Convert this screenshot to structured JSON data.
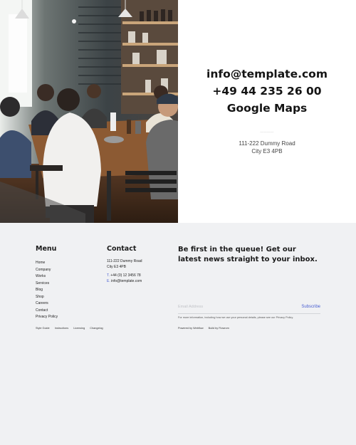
{
  "hero": {
    "photo_alt": "people-meeting-photo",
    "email": "info@template.com",
    "phone": "+49 44 235 26 00",
    "maps_link": "Google Maps",
    "separator_label": "————",
    "address_line1": "111-222 Dummy Road",
    "address_line2": "City E3 4PB"
  },
  "footer": {
    "menu": {
      "title": "Menu",
      "items": [
        "Home",
        "Company",
        "Works",
        "Services",
        "Blog",
        "Shop",
        "Careers",
        "Contact",
        "Privacy Policy"
      ]
    },
    "contact": {
      "title": "Contact",
      "address_line1": "111-222 Dummy Road",
      "address_line2": "City E3 4PB",
      "phone_prefix": "T.",
      "phone": "+44 (0) 12 3456 78",
      "email_prefix": "E.",
      "email": "info@template.com"
    },
    "newsletter": {
      "title": "Be first in the queue! Get our latest news straight to your inbox.",
      "email_placeholder": "Email Address",
      "subscribe_label": "Subscribe",
      "privacy_note": "For more information, including how we use your personal details, please see our Privacy Policy."
    },
    "legal_links": [
      "Style Guide",
      "Instructions",
      "Licensing",
      "Changelog"
    ],
    "credits": [
      "Powered by Webflow",
      "Build by Flowrom"
    ]
  },
  "colors": {
    "accent": "#4a5fd1",
    "footer_bg": "#f0f1f3",
    "panel_bg": "#ffffff",
    "text_dark": "#1b1b1b"
  }
}
